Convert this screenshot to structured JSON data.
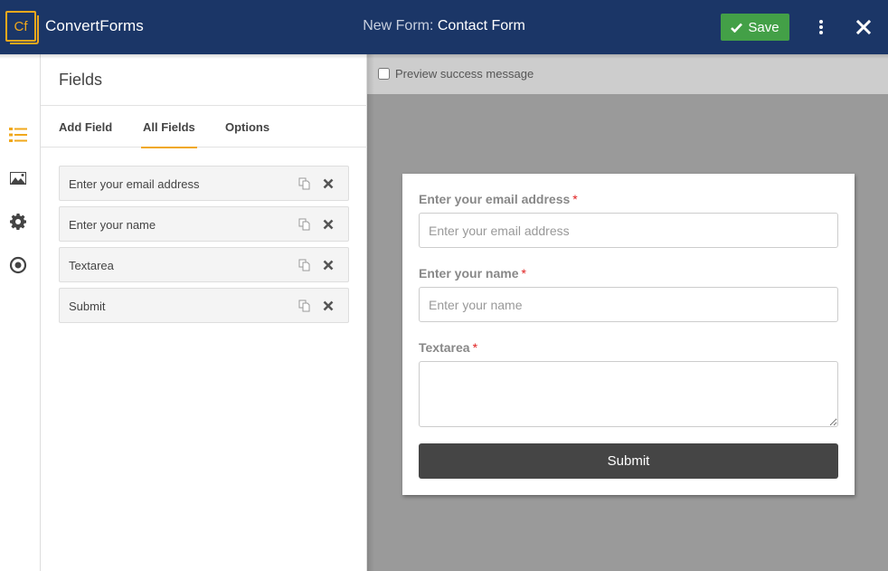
{
  "header": {
    "logo_text": "ConvertForms",
    "logo_mark": "Cf",
    "title_prefix": "New Form:",
    "title_name": "Contact Form",
    "save_label": "Save",
    "colors": {
      "background": "#1b3667",
      "accent": "#f0a81c",
      "save": "#43a047"
    }
  },
  "rail": {
    "items": [
      {
        "icon": "list-icon",
        "active": true
      },
      {
        "icon": "image-icon",
        "active": false
      },
      {
        "icon": "gear-icon",
        "active": false
      },
      {
        "icon": "target-icon",
        "active": false
      }
    ]
  },
  "panel": {
    "title": "Fields",
    "tabs": [
      {
        "label": "Add Field",
        "active": false
      },
      {
        "label": "All Fields",
        "active": true
      },
      {
        "label": "Options",
        "active": false
      }
    ],
    "fields": [
      {
        "label": "Enter your email address"
      },
      {
        "label": "Enter your name"
      },
      {
        "label": "Textarea"
      },
      {
        "label": "Submit"
      }
    ]
  },
  "preview": {
    "checkbox_label": "Preview success message",
    "checkbox_checked": false,
    "form": {
      "fields": [
        {
          "label": "Enter your email address",
          "required_mark": "*",
          "placeholder": "Enter your email address"
        },
        {
          "label": "Enter your name",
          "required_mark": "*",
          "placeholder": "Enter your name"
        },
        {
          "label": "Textarea",
          "required_mark": "*"
        }
      ],
      "submit_label": "Submit"
    }
  }
}
